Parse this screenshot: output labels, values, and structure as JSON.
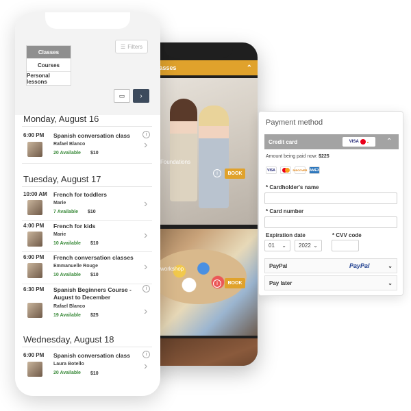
{
  "back_phone": {
    "header_label": "lasses",
    "card1_caption": "Foundations",
    "card2_caption": "workshop",
    "book_label": "BOOK",
    "info_glyph": "i",
    "chevron_up": "⌃"
  },
  "front_phone": {
    "segments": [
      "Classes",
      "Courses",
      "Personal lessons"
    ],
    "active_segment": "Classes",
    "filters_label": "Filters",
    "days": [
      {
        "title": "Monday, August 16",
        "classes": [
          {
            "time": "6:00 PM",
            "title": "Spanish conversation class",
            "teacher": "Rafael Blanco",
            "available": "20 Available",
            "price": "$10"
          }
        ]
      },
      {
        "title": "Tuesday, August 17",
        "classes": [
          {
            "time": "10:00 AM",
            "title": "French for toddlers",
            "teacher": "Marie",
            "available": "7 Available",
            "price": "$10"
          },
          {
            "time": "4:00 PM",
            "title": "French for kids",
            "teacher": "Marie",
            "available": "10 Available",
            "price": "$10"
          },
          {
            "time": "6:00 PM",
            "title": "French conversation classes",
            "teacher": "Emmanuelle Rouge",
            "available": "10 Available",
            "price": "$10"
          },
          {
            "time": "6:30 PM",
            "title": "Spanish Beginners Course - August to December",
            "teacher": "Rafael Blanco",
            "available": "19 Available",
            "price": "$25"
          }
        ]
      },
      {
        "title": "Wednesday, August 18",
        "classes": [
          {
            "time": "6:00 PM",
            "title": "Spanish conversation class",
            "teacher": "Laura Botello",
            "available": "20 Available",
            "price": "$10"
          }
        ]
      }
    ]
  },
  "payment": {
    "title": "Payment method",
    "credit_card_label": "Credit card",
    "amount_label": "Amount being paid now:",
    "amount_value": "$225",
    "card_brands": [
      "VISA",
      "MC",
      "DISCOVER",
      "AMEX"
    ],
    "cardholder_label": "Cardholder's name",
    "card_number_label": "Card number",
    "expiration_label": "Expiration date",
    "month_value": "01",
    "year_value": "2022",
    "cvv_label": "CVV code",
    "paypal_label": "PayPal",
    "paypal_logo": "PayPal",
    "pay_later_label": "Pay later",
    "required_mark": "*"
  },
  "colors": {
    "accent": "#e0a22c",
    "nav_dark": "#3c4a5c",
    "available_green": "#3a8a3a"
  }
}
